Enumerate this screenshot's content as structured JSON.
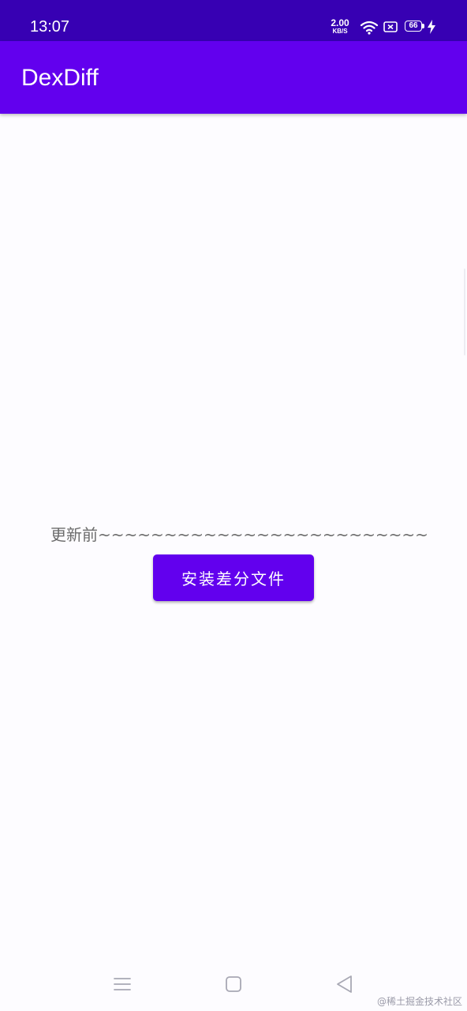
{
  "status_bar": {
    "time": "13:07",
    "net_speed_value": "2.00",
    "net_speed_unit": "KB/S",
    "battery_level": "66",
    "icons": [
      "wifi-icon",
      "sim-card-icon",
      "battery-icon",
      "charging-bolt-icon"
    ]
  },
  "app_bar": {
    "title": "DexDiff"
  },
  "content": {
    "label": "更新前~~~~~~~~~~~~~~~~~~~~~~~~~~~~~~~~~~~~~~",
    "install_button_label": "安装差分文件"
  },
  "nav_bar": {
    "icons": [
      "recents-icon",
      "home-icon",
      "back-icon"
    ]
  },
  "watermark": "@稀土掘金技术社区",
  "colors": {
    "status_bar": "#3700b3",
    "app_bar": "#6200ee",
    "button": "#6200ee",
    "background": "#fdfcff",
    "body_text": "#6b6b6b"
  }
}
